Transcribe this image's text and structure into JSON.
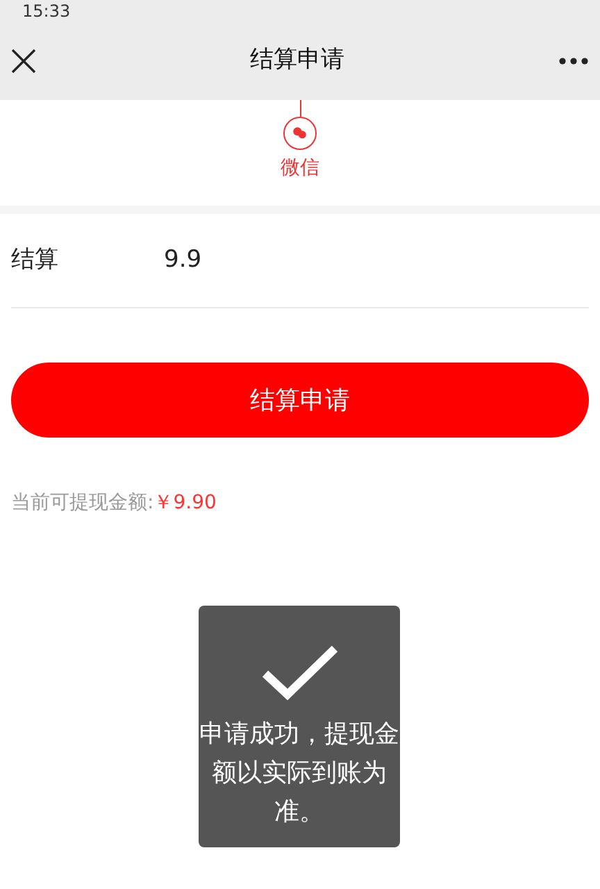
{
  "status_bar": {
    "time": "15:33"
  },
  "nav": {
    "title": "结算申请"
  },
  "payment_methods": [
    {
      "label": "微信",
      "selected": true
    }
  ],
  "form": {
    "label": "结算",
    "value": "9.9"
  },
  "submit_button": "结算申请",
  "balance": {
    "label": "当前可提现金额:",
    "amount": "￥9.90"
  },
  "toast": {
    "message": "申请成功，提现金额以实际到账为准。"
  }
}
